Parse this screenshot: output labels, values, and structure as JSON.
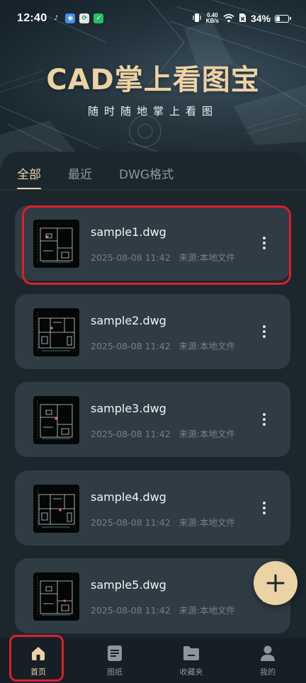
{
  "status_bar": {
    "time": "12:40",
    "net_speed_value": "0.40",
    "net_speed_unit": "KB/s",
    "battery_percent": "34%",
    "battery_level": 0.34
  },
  "header": {
    "title": "CAD掌上看图宝",
    "subtitle": "随时随地掌上看图"
  },
  "tabs": [
    {
      "label": "全部",
      "active": true
    },
    {
      "label": "最近",
      "active": false
    },
    {
      "label": "DWG格式",
      "active": false
    }
  ],
  "files": [
    {
      "name": "sample1.dwg",
      "date": "2025-08-08 11:42",
      "source": "来源:本地文件"
    },
    {
      "name": "sample2.dwg",
      "date": "2025-08-08 11:42",
      "source": "来源:本地文件"
    },
    {
      "name": "sample3.dwg",
      "date": "2025-08-08 11:42",
      "source": "来源:本地文件"
    },
    {
      "name": "sample4.dwg",
      "date": "2025-08-08 11:42",
      "source": "来源:本地文件"
    },
    {
      "name": "sample5.dwg",
      "date": "2025-08-08 11:42",
      "source": "来源:本地文件"
    }
  ],
  "bottom_nav": [
    {
      "label": "首页",
      "icon": "home-icon",
      "active": true
    },
    {
      "label": "图纸",
      "icon": "drawing-list-icon",
      "active": false
    },
    {
      "label": "收藏夹",
      "icon": "folder-icon",
      "active": false
    },
    {
      "label": "我的",
      "icon": "user-icon",
      "active": false
    }
  ],
  "colors": {
    "accent": "#ecd3a5",
    "panel_bg": "#1b262d",
    "card_bg": "#303c44",
    "highlight": "#dc1f2a"
  }
}
